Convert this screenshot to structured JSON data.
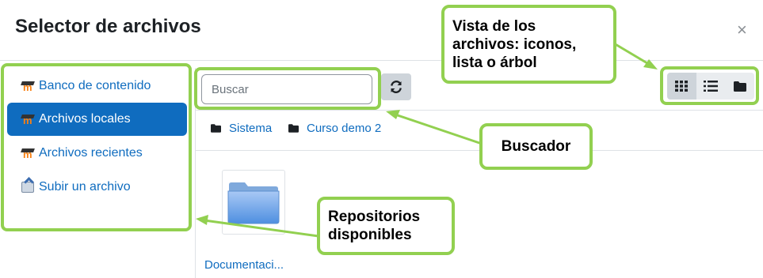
{
  "dialog": {
    "title": "Selector de archivos",
    "close_symbol": "×"
  },
  "sidebar": {
    "items": [
      {
        "label": "Banco de contenido",
        "icon": "moodle-icon",
        "active": false
      },
      {
        "label": "Archivos locales",
        "icon": "moodle-icon",
        "active": true
      },
      {
        "label": "Archivos recientes",
        "icon": "moodle-icon",
        "active": false
      },
      {
        "label": "Subir un archivo",
        "icon": "upload-icon",
        "active": false
      }
    ]
  },
  "toolbar": {
    "search_placeholder": "Buscar",
    "refresh_icon": "refresh-icon",
    "view_buttons": [
      {
        "name": "icons",
        "icon": "grid-icon",
        "active": true
      },
      {
        "name": "list",
        "icon": "list-icon",
        "active": false
      },
      {
        "name": "tree",
        "icon": "folder-icon",
        "active": false
      }
    ]
  },
  "breadcrumb": [
    {
      "label": "Sistema",
      "icon": "folder-icon"
    },
    {
      "label": "Curso demo 2",
      "icon": "folder-icon"
    }
  ],
  "files": [
    {
      "name": "Documentaci...",
      "icon": "folder-icon"
    }
  ],
  "annotations": {
    "view_modes": "Vista de los archivos: iconos, lista o árbol",
    "search": "Buscador",
    "repositories": "Repositorios disponibles"
  },
  "colors": {
    "accent": "#0f6cbf",
    "callout_border": "#92d050"
  }
}
